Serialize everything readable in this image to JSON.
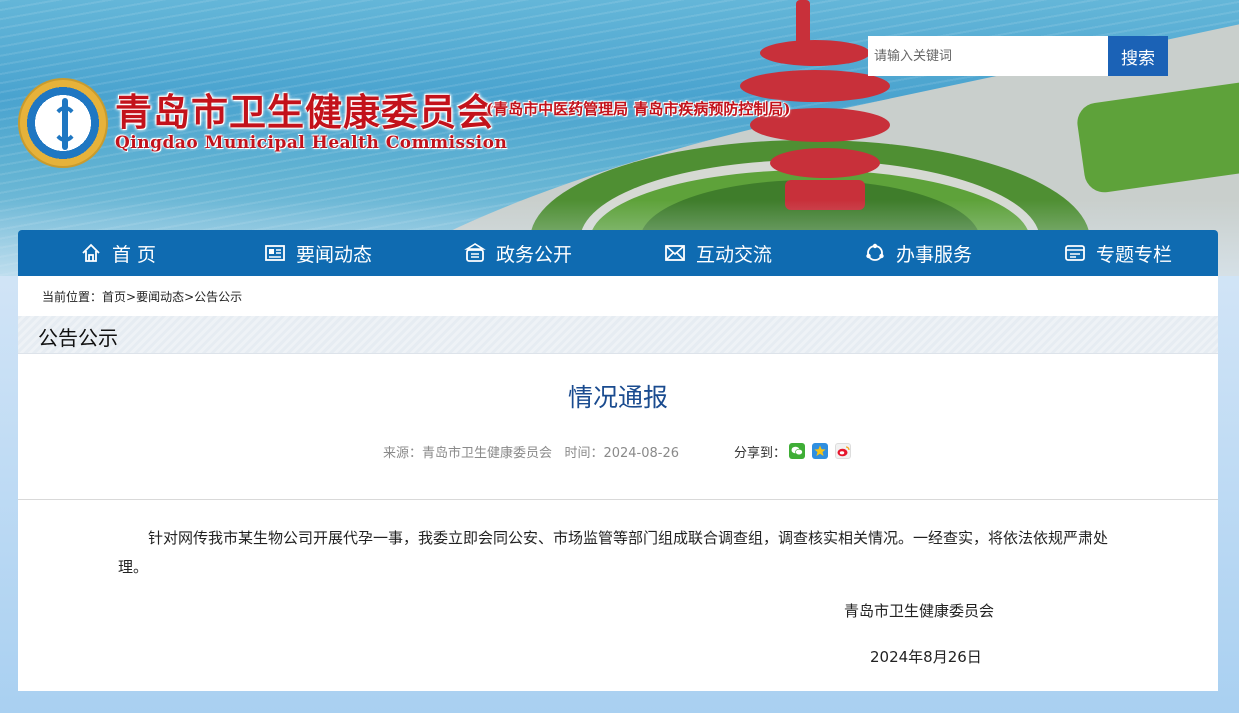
{
  "header": {
    "title": "青岛市卫生健康委员会",
    "subtitle": "(青岛市中医药管理局 青岛市疾病预防控制局)",
    "title_en": "Qingdao Municipal Health Commission",
    "logo_icon": "health-commission-logo",
    "search": {
      "placeholder": "请输入关键词",
      "button_label": "搜索"
    }
  },
  "nav": {
    "items": [
      {
        "label": "首 页",
        "icon": "home-icon"
      },
      {
        "label": "要闻动态",
        "icon": "news-icon"
      },
      {
        "label": "政务公开",
        "icon": "government-icon"
      },
      {
        "label": "互动交流",
        "icon": "interaction-icon"
      },
      {
        "label": "办事服务",
        "icon": "service-icon"
      },
      {
        "label": "专题专栏",
        "icon": "topic-icon"
      }
    ]
  },
  "breadcrumb": {
    "prefix": "当前位置：",
    "items": [
      "首页",
      "要闻动态",
      "公告公示"
    ],
    "separator": ">"
  },
  "section": {
    "title": "公告公示"
  },
  "article": {
    "title": "情况通报",
    "source_label": "来源：",
    "source": "青岛市卫生健康委员会",
    "time_label": "时间：",
    "time": "2024-08-26",
    "share_label": "分享到：",
    "share_icons": [
      "wechat-icon",
      "qzone-icon",
      "weibo-icon"
    ],
    "body": "针对网传我市某生物公司开展代孕一事，我委立即会同公安、市场监管等部门组成联合调查组，调查核实相关情况。一经查实，将依法依规严肃处理。",
    "sign_org": "青岛市卫生健康委员会",
    "sign_date": "2024年8月26日"
  },
  "colors": {
    "nav_bg": "#0f6bb1",
    "title_red": "#c3121b",
    "article_title": "#1a4b8f",
    "search_button": "#1b62b6"
  }
}
